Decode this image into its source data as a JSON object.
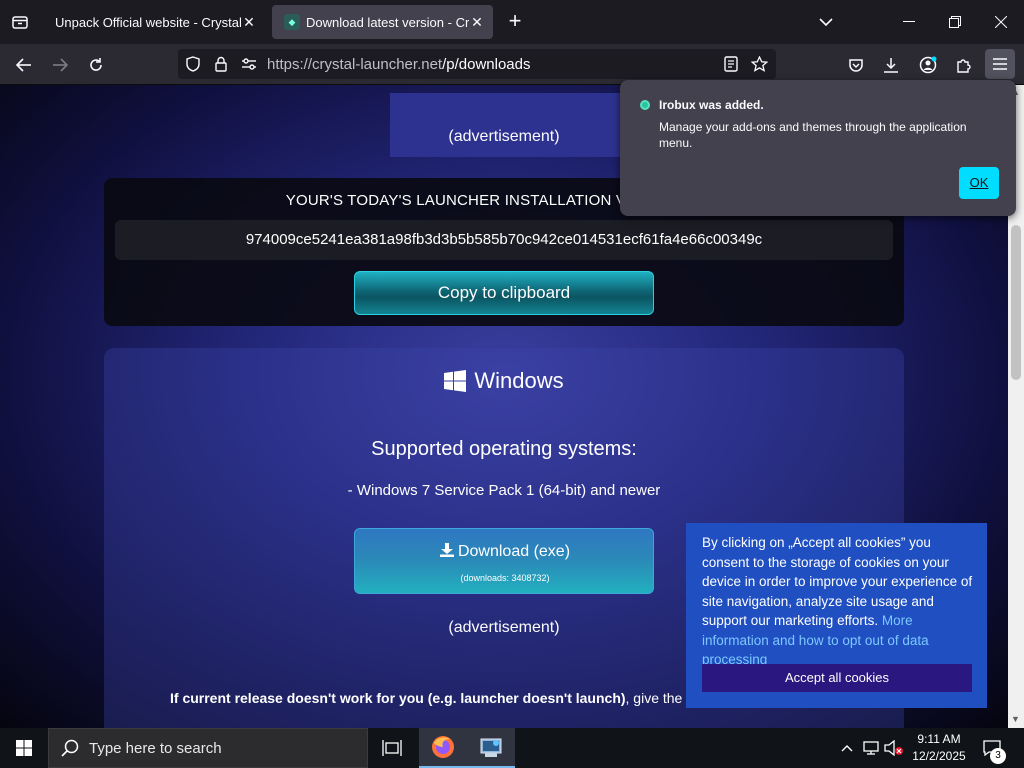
{
  "browser": {
    "tabs": [
      {
        "title": "Unpack Official website - Crystal Launc"
      },
      {
        "title": "Download latest version - Crystal"
      }
    ],
    "url": {
      "host": "https://crystal-launcher.net",
      "path": "/p/downloads"
    }
  },
  "page": {
    "ad_label_top": "(advertisement)",
    "verify_title": "YOUR'S TODAY'S LAUNCHER INSTALLATION VERIFICATION",
    "hash": "974009ce5241ea381a98fb3d3b5b585b70c942ce014531ecf61fa4e66c00349c",
    "copy_button": "Copy to clipboard",
    "platform": "Windows",
    "supported_title": "Supported operating systems:",
    "supported_item": "- Windows 7 Service Pack 1 (64-bit) and newer",
    "download_button": "Download (exe)",
    "download_count": "(downloads: 3408732)",
    "ad_label_bottom": "(advertisement)",
    "info_bold": "If current release doesn't work for you (e.g. launcher doesn't launch)",
    "info_rest": ", give the a"
  },
  "addon_popup": {
    "title": "Irobux was added.",
    "body": "Manage your add-ons and themes through the application menu.",
    "ok": "OK"
  },
  "cookie_banner": {
    "text": "By clicking on „Accept all cookies” you consent to the storage of cookies on your device in order to improve your experience of site navigation, analyze site usage and support our marketing efforts.",
    "link": "More information and how to opt out of data processing",
    "accept": "Accept all cookies"
  },
  "taskbar": {
    "search_placeholder": "Type here to search",
    "time": "9:11 AM",
    "date": "12/2/2025",
    "notification_count": "3"
  }
}
